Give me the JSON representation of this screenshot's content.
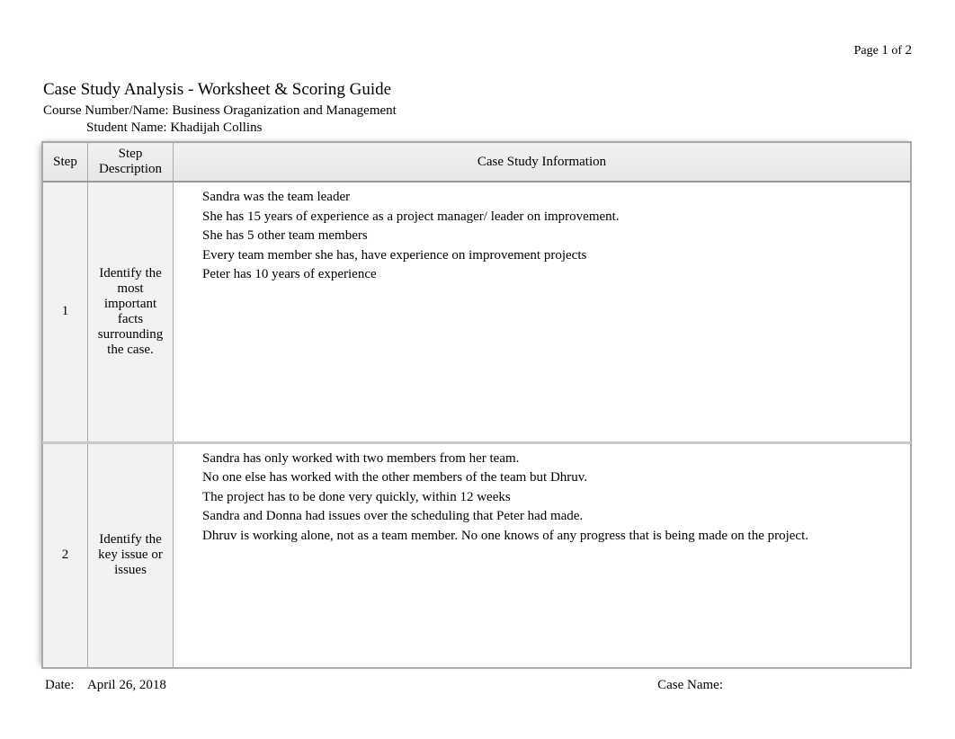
{
  "page": {
    "label": "Page",
    "current": "1",
    "of_label": "of",
    "total": "2"
  },
  "title": "Case Study Analysis - Worksheet & Scoring Guide",
  "course_label": "Course Number/Name:",
  "course_value": "Business Oraganization and Management",
  "student_label": "Student Name:",
  "student_value": "Khadijah Collins",
  "headers": {
    "step": "Step",
    "desc": "Step Description",
    "info": "Case Study Information"
  },
  "rows": [
    {
      "step": "1",
      "desc": "Identify the most important facts surrounding the case.",
      "bullets": [
        "Sandra was the team leader",
        "She has 15 years of experience as a project manager/ leader on improvement.",
        "She has 5 other team members",
        "Every team member she has, have experience on improvement projects",
        "Peter has 10 years of experience",
        ""
      ]
    },
    {
      "step": "2",
      "desc": "Identify the key issue or issues",
      "bullets": [
        "Sandra has only worked with two members from her team.",
        "No one else has worked with the other members of the team but Dhruv.",
        "The project has to be done very quickly, within 12 weeks",
        "Sandra and Donna had issues over the scheduling that Peter had made.",
        "Dhruv is working alone, not as a team member. No one knows of any progress that is being made on the project.",
        ""
      ]
    }
  ],
  "footer": {
    "date_label": "Date:",
    "date_value": "April 26, 2018",
    "case_label": "Case Name:",
    "case_value": ""
  }
}
